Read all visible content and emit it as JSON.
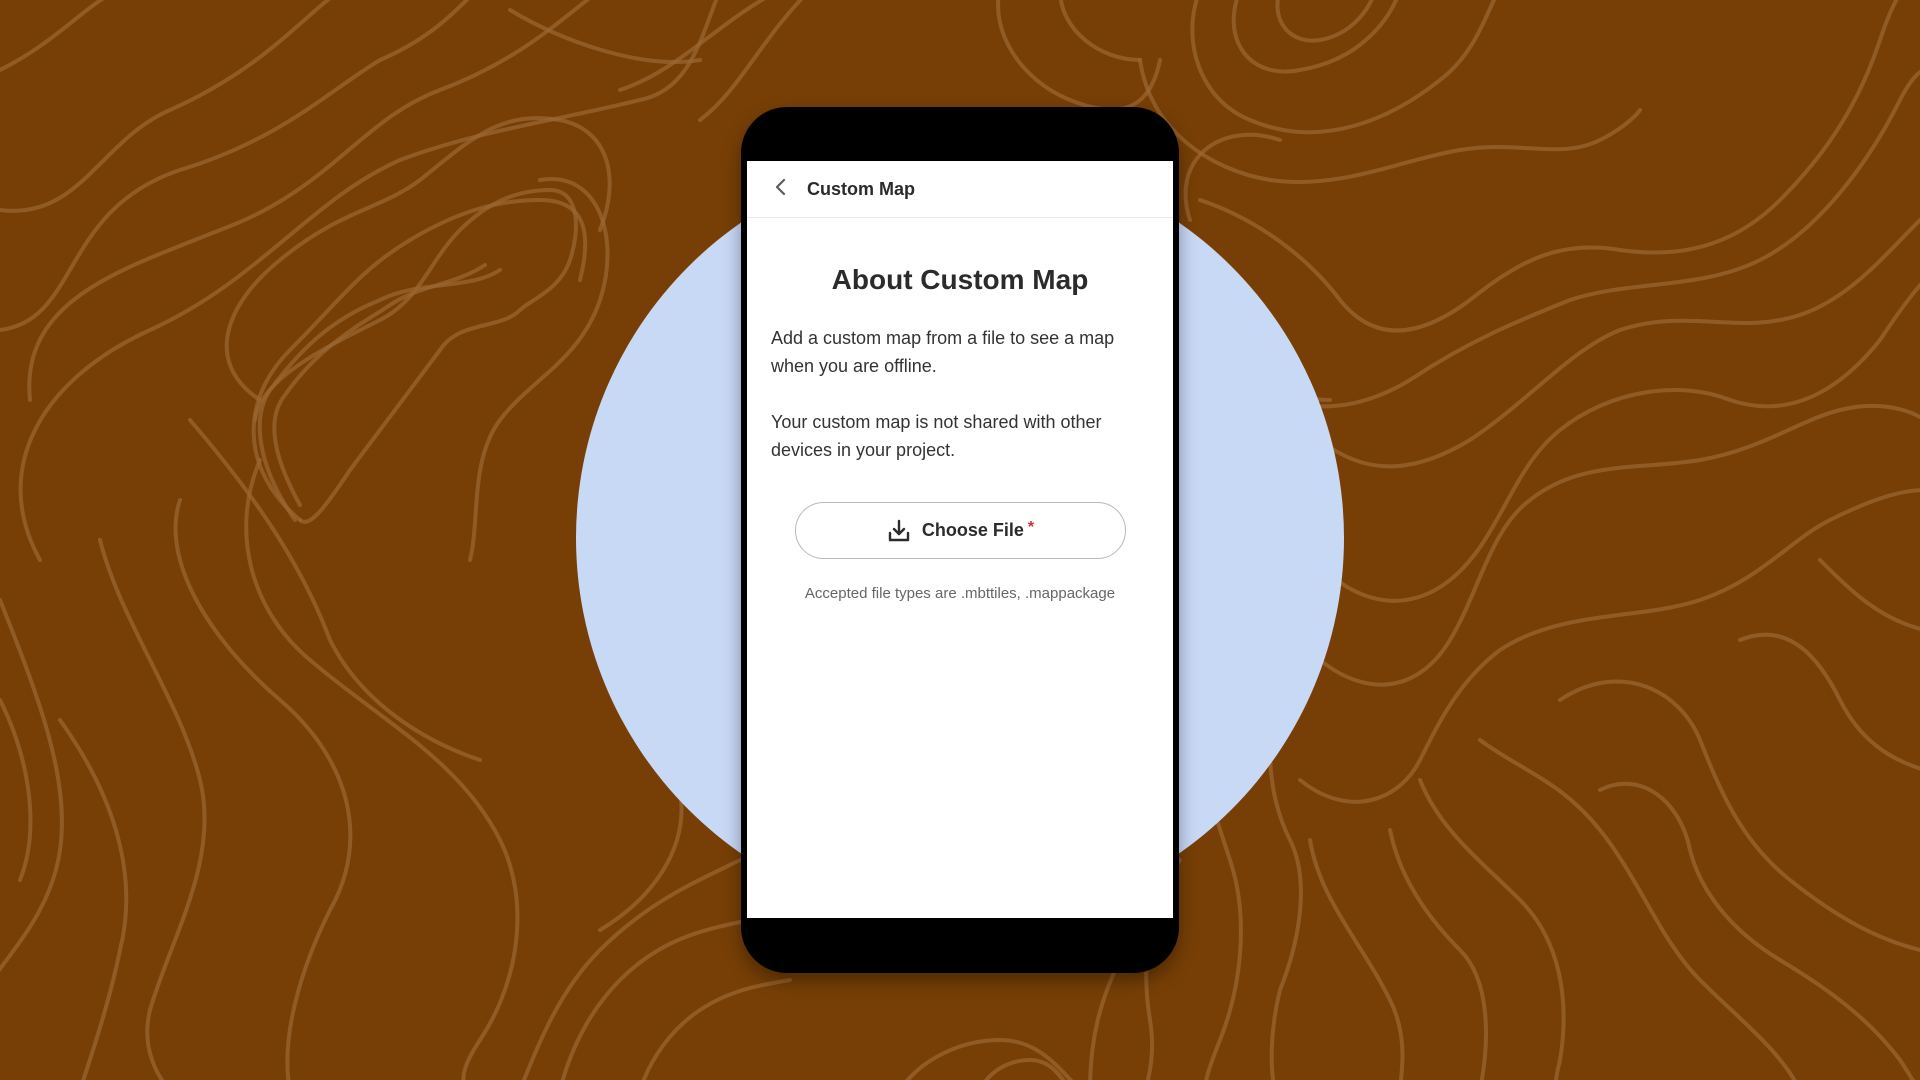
{
  "header": {
    "title": "Custom Map",
    "back_icon": "chevron-left-icon"
  },
  "main": {
    "heading": "About Custom Map",
    "paragraph_1": "Add a custom map from a file to see a map when you are offline.",
    "paragraph_2": "Your custom map is not shared with other devices in your project.",
    "choose_file": {
      "label": "Choose File",
      "required_marker": "*",
      "icon": "download-icon"
    },
    "accepted_types": "Accepted file types are .mbttiles, .mappackage"
  },
  "colors": {
    "background": "#773f06",
    "contour_lines": "#9a6532",
    "circle": "#c8d9f6",
    "required": "#d32f2f"
  }
}
